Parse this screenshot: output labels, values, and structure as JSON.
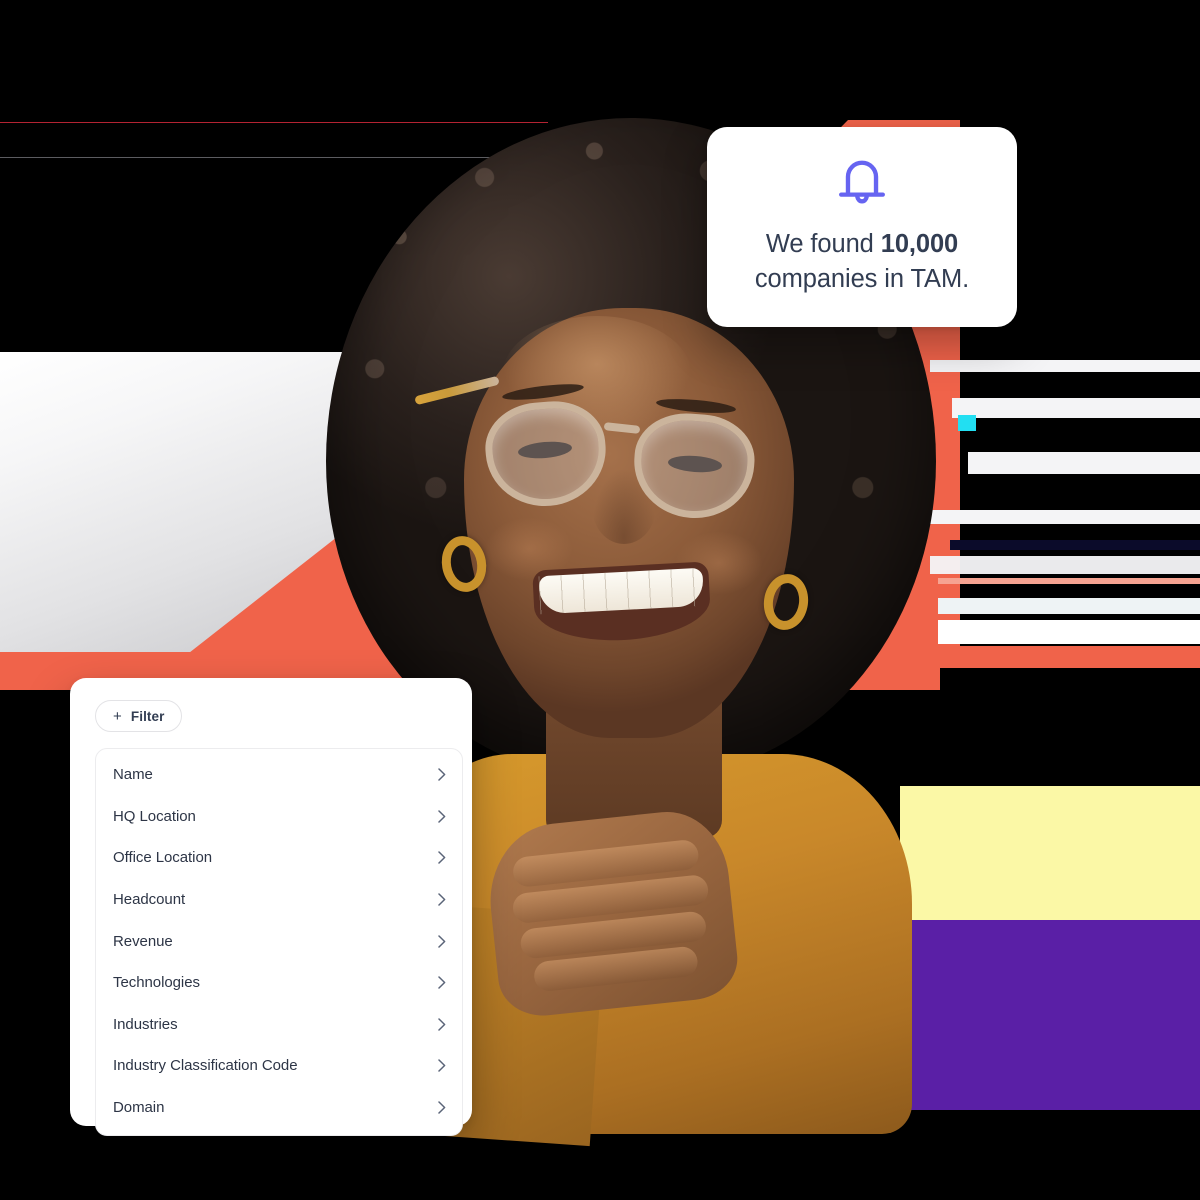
{
  "notification": {
    "icon": "bell-icon",
    "text_prefix": "We found ",
    "count": "10,000",
    "text_suffix": " companies in TAM."
  },
  "filter_panel": {
    "add_filter_button": {
      "icon": "plus-icon",
      "plus_glyph": "+",
      "label": "Filter"
    },
    "rows": [
      {
        "label": "Name",
        "chevron": "chevron-right-icon"
      },
      {
        "label": "HQ Location",
        "chevron": "chevron-right-icon"
      },
      {
        "label": "Office Location",
        "chevron": "chevron-right-icon"
      },
      {
        "label": "Headcount",
        "chevron": "chevron-right-icon"
      },
      {
        "label": "Revenue",
        "chevron": "chevron-right-icon"
      },
      {
        "label": "Technologies",
        "chevron": "chevron-right-icon"
      },
      {
        "label": "Industries",
        "chevron": "chevron-right-icon"
      },
      {
        "label": "Industry Classification Code",
        "chevron": "chevron-right-icon"
      },
      {
        "label": "Domain",
        "chevron": "chevron-right-icon"
      }
    ]
  },
  "colors": {
    "background": "#000000",
    "accent_coral": "#F0634A",
    "accent_yellow": "#FBF8A6",
    "accent_purple": "#5A1FA6",
    "bell_indigo": "#6664F1",
    "text_dark": "#323D52",
    "card_white": "#FFFFFF",
    "border_gray": "#E3E3E6"
  }
}
